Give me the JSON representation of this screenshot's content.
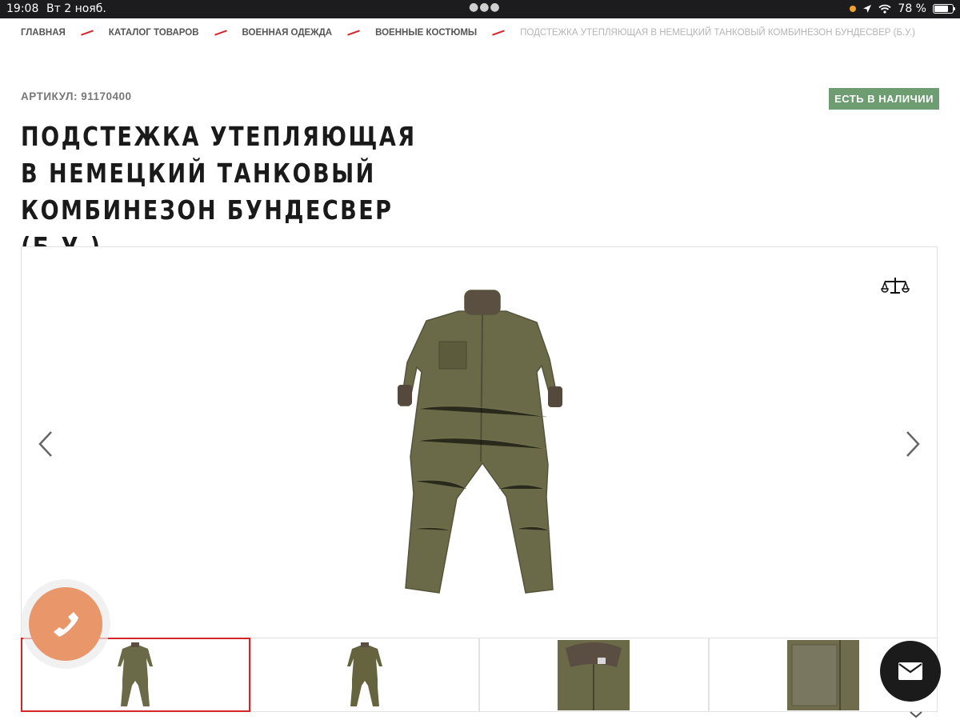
{
  "status_bar": {
    "time": "19:08",
    "date": "Вт 2 нояб.",
    "battery_percent": "78 %",
    "battery_level": 0.78
  },
  "breadcrumb": {
    "items": [
      "ГЛАВНАЯ",
      "КАТАЛОГ ТОВАРОВ",
      "ВОЕННАЯ ОДЕЖДА",
      "ВОЕННЫЕ КОСТЮМЫ"
    ],
    "current": "ПОДСТЕЖКА УТЕПЛЯЮЩАЯ В НЕМЕЦКИЙ ТАНКОВЫЙ КОМБИНЕЗОН БУНДЕСВЕР (Б.У.)"
  },
  "product": {
    "sku": "АРТИКУЛ: 91170400",
    "stock_badge": "ЕСТЬ В НАЛИЧИИ",
    "title": "ПОДСТЕЖКА УТЕПЛЯЮЩАЯ В НЕМЕЦКИЙ ТАНКОВЫЙ КОМБИНЕЗОН БУНДЕСВЕР (Б.У.)"
  },
  "gallery": {
    "thumbnail_count": 4,
    "active_thumbnail": 1
  },
  "colors": {
    "accent_red": "#d4262a",
    "stock_green": "#6f9d72",
    "phone_button": "#e8966a",
    "garment_olive": "#6b6a48"
  },
  "icons": [
    "compare-scales-icon",
    "chevron-left-icon",
    "chevron-right-icon",
    "phone-icon",
    "mail-icon",
    "chevron-down-icon"
  ]
}
